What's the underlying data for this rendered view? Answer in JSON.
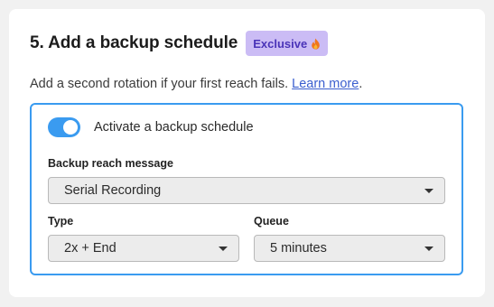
{
  "section": {
    "title": "5. Add a backup schedule",
    "badge": "Exclusive",
    "badge_icon": "flame-icon",
    "description": "Add a second rotation if your first reach fails.",
    "learn_more": "Learn more",
    "description_end": "."
  },
  "backup": {
    "toggle_label": "Activate a backup schedule",
    "toggle_on": true,
    "message_label": "Backup reach message",
    "message_value": "Serial Recording",
    "type_label": "Type",
    "type_value": "2x + End",
    "queue_label": "Queue",
    "queue_value": "5 minutes"
  },
  "colors": {
    "accent": "#3a9bf0",
    "badge_bg": "#cbbcf5",
    "badge_text": "#4a34b8",
    "link": "#3b5fcf"
  }
}
